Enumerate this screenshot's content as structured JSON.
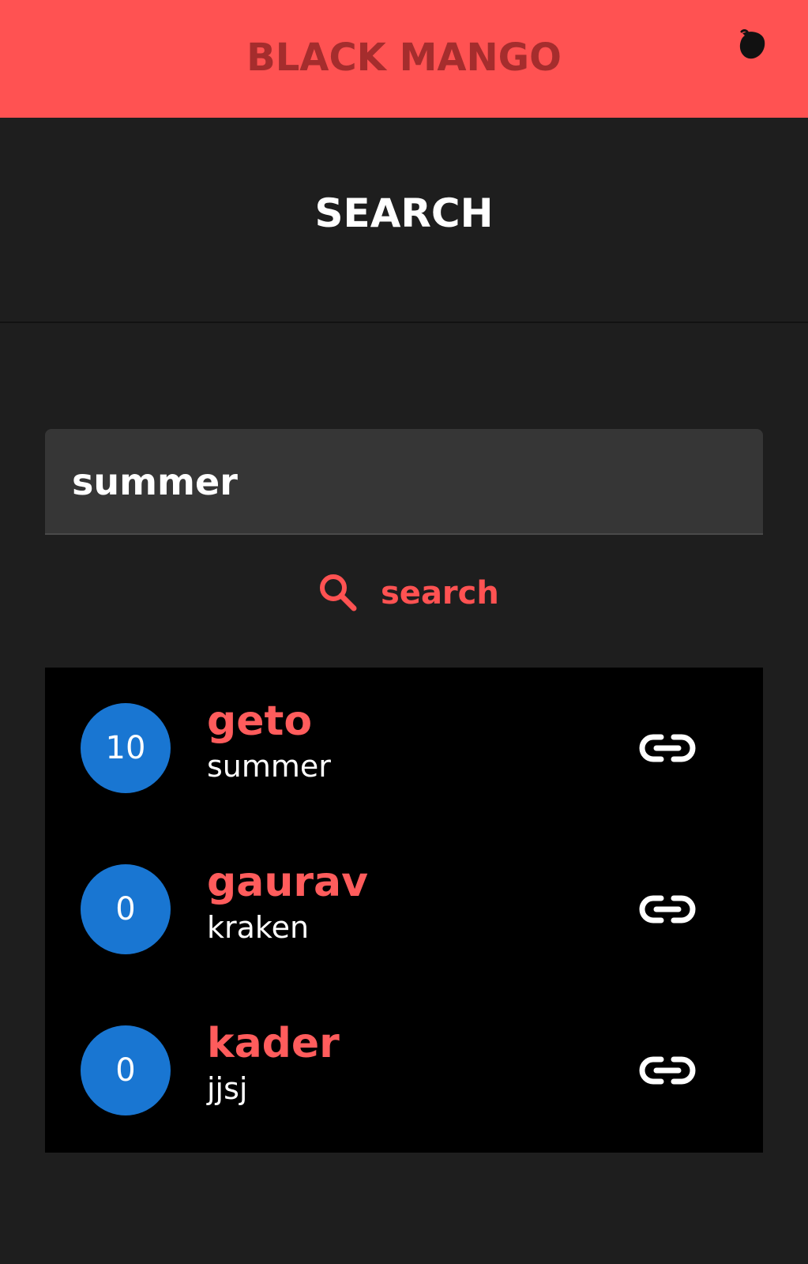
{
  "appbar": {
    "title": "BLACK MANGO",
    "icon": "mango-icon",
    "background": "#ff5252",
    "title_color": "#a52d2d"
  },
  "page": {
    "title": "SEARCH"
  },
  "search": {
    "value": "summer",
    "placeholder": "",
    "button_label": "search",
    "button_icon": "search-icon"
  },
  "results": [
    {
      "count": "10",
      "name": "geto",
      "subtitle": "summer",
      "action_icon": "link-icon"
    },
    {
      "count": "0",
      "name": "gaurav",
      "subtitle": "kraken",
      "action_icon": "link-icon"
    },
    {
      "count": "0",
      "name": "kader",
      "subtitle": "jjsj",
      "action_icon": "link-icon"
    }
  ],
  "colors": {
    "accent": "#ff5252",
    "avatar": "#1976d2",
    "background": "#1e1e1e",
    "list_background": "#000000"
  }
}
